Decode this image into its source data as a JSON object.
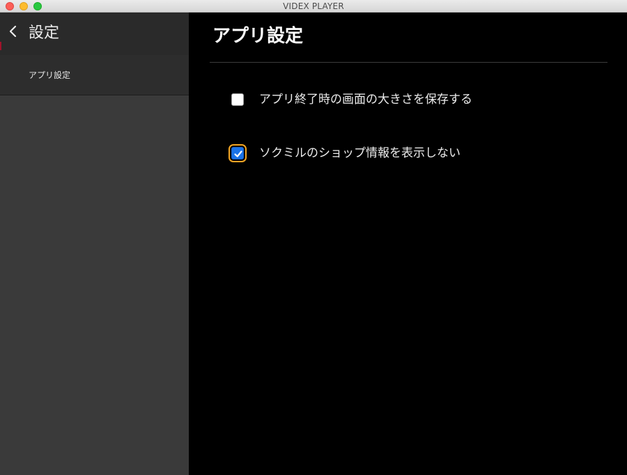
{
  "window": {
    "title": "VIDEX PLAYER"
  },
  "sidebar": {
    "title": "設定",
    "items": [
      {
        "label": "アプリ設定",
        "selected": true
      }
    ]
  },
  "main": {
    "title": "アプリ設定",
    "options": [
      {
        "label": "アプリ終了時の画面の大きさを保存する",
        "checked": false
      },
      {
        "label": "ソクミルのショップ情報を表示しない",
        "checked": true,
        "focused": true
      }
    ]
  },
  "icons": {
    "back": "chevron-left-icon",
    "check": "checkmark-icon"
  },
  "colors": {
    "checkbox_checked": "#1a73e8",
    "focus_ring": "#f4a623",
    "sidebar_bg": "#3a3a3a",
    "sidebar_header_bg": "#2a2a2a",
    "main_bg": "#000000"
  }
}
